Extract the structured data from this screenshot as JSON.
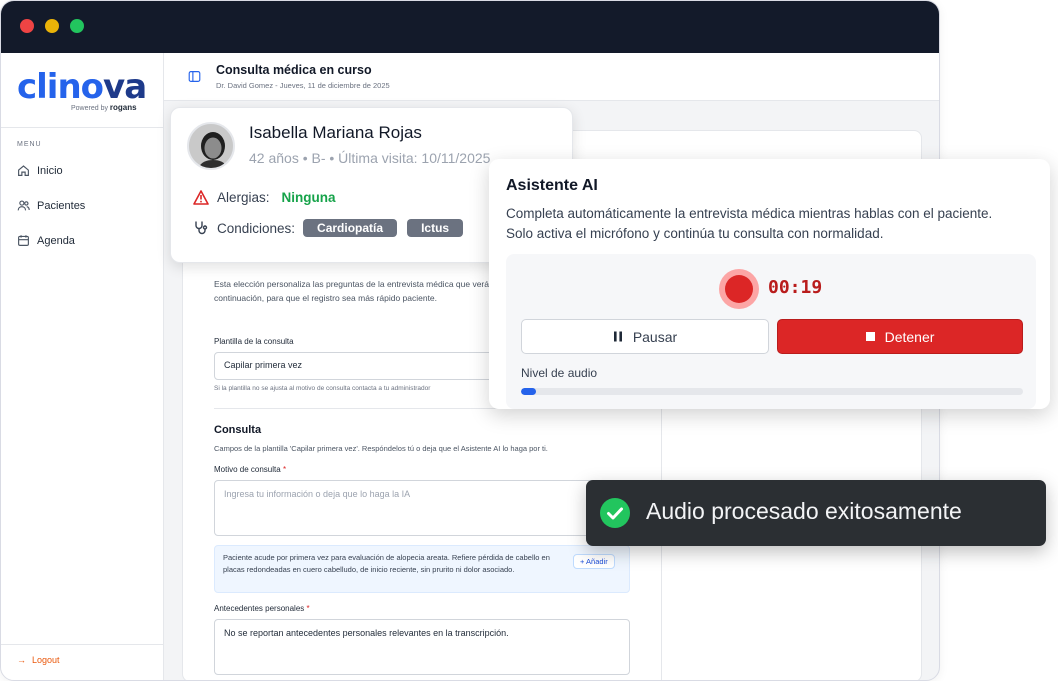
{
  "window": {
    "title_bar_colors": {
      "close": "#ef4444",
      "minimize": "#eab308",
      "maximize": "#22c55e"
    }
  },
  "brand": {
    "logo_text_start": "clino",
    "logo_text_end": "va",
    "logo_color": "#2563eb",
    "powered_by": "Powered by",
    "powered_by_brand": "rogans"
  },
  "sidebar": {
    "menu_label": "MENU",
    "items": [
      {
        "label": "Inicio",
        "icon": "home-icon"
      },
      {
        "label": "Pacientes",
        "icon": "users-icon"
      },
      {
        "label": "Agenda",
        "icon": "calendar-icon"
      }
    ],
    "logout": "Logout"
  },
  "header": {
    "title": "Consulta médica en curso",
    "subtitle": "Dr. David Gomez - Jueves, 11 de diciembre de 2025"
  },
  "patient": {
    "name": "Isabella Mariana Rojas",
    "meta": "42 años • B- • Última visita: 10/11/2025",
    "allergies_label": "Alergias:",
    "allergies_value": "Ninguna",
    "conditions_label": "Condiciones:",
    "conditions": [
      "Cardiopatía",
      "Ictus"
    ]
  },
  "form": {
    "template_intro": "Esta elección personaliza las preguntas de la entrevista médica que verás a continuación, para que el registro sea más rápido paciente.",
    "template_label": "Plantilla de la consulta",
    "template_value": "Capilar primera vez",
    "template_hint": "Si la plantilla no se ajusta al motivo de consulta contacta a tu administrador",
    "consulta_heading": "Consulta",
    "consulta_desc": "Campos de la plantilla 'Capilar primera vez'. Respóndelos tú o deja que el Asistente AI lo haga por ti.",
    "motivo_label": "Motivo de consulta",
    "motivo_placeholder": "Ingresa tu información o deja que lo haga la IA",
    "suggestion_text": "Paciente acude por primera vez para evaluación de alopecia areata. Refiere pérdida de cabello en placas redondeadas en cuero cabelludo, de inicio reciente, sin prurito ni dolor asociado.",
    "add_button": "+ Añadir",
    "antecedentes_label": "Antecedentes personales",
    "antecedentes_value": "No se reportan antecedentes personales relevantes en la transcripción."
  },
  "assistant": {
    "title": "Asistente AI",
    "description": "Completa automáticamente la entrevista médica mientras hablas con el paciente. Solo activa el micrófono y continúa tu consulta con normalidad.",
    "timer": "00:19",
    "pause_label": "Pausar",
    "stop_label": "Detener",
    "audio_level_label": "Nivel de audio",
    "audio_level": 0.03
  },
  "toast": {
    "message": "Audio procesado exitosamente"
  }
}
